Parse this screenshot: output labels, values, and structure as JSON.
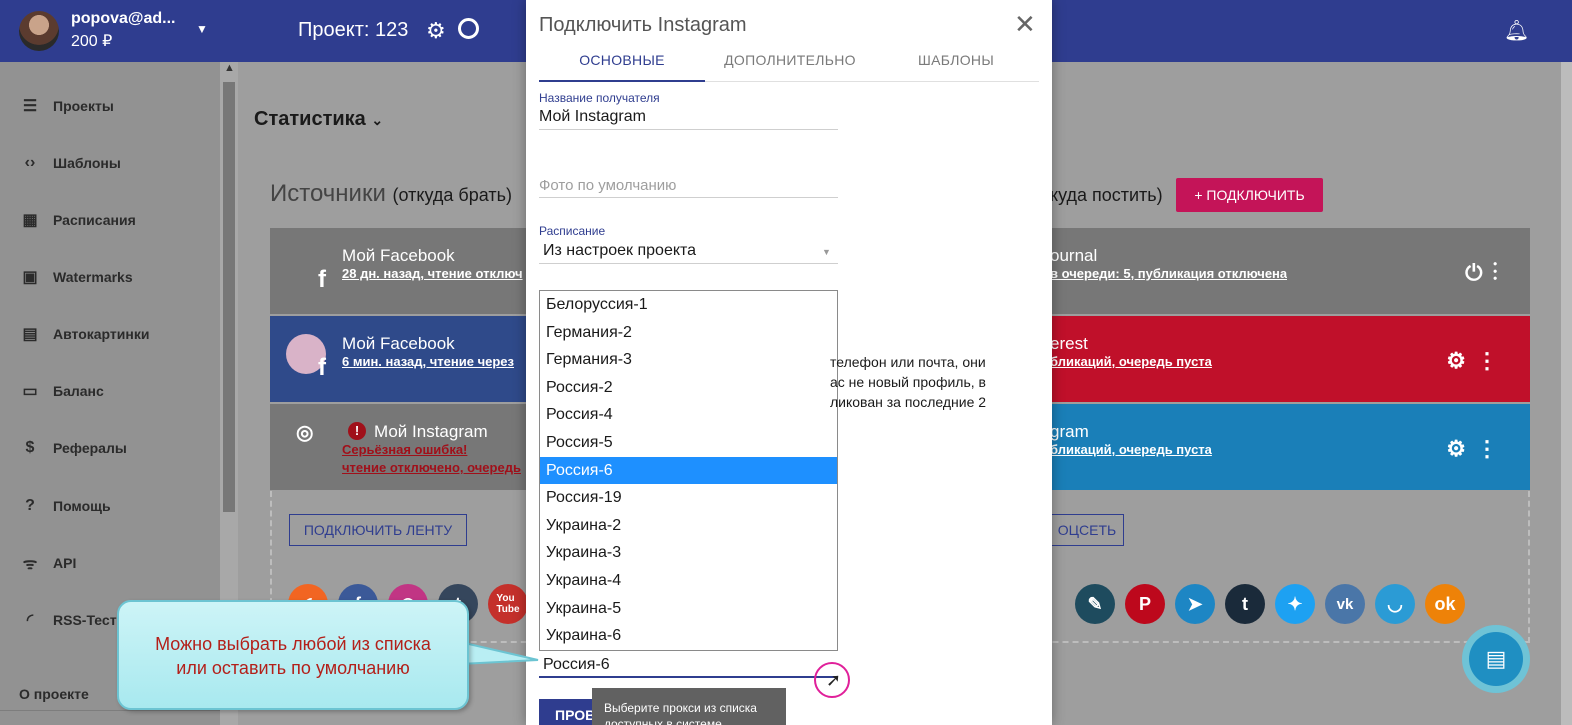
{
  "topbar": {
    "user_name": "popova@ad...",
    "user_balance": "200 ₽",
    "project_title": "Проект: 123"
  },
  "sidebar": {
    "items": [
      {
        "label": "Проекты",
        "icon": "list-icon"
      },
      {
        "label": "Шаблоны",
        "icon": "code-icon"
      },
      {
        "label": "Расписания",
        "icon": "calendar-icon"
      },
      {
        "label": "Watermarks",
        "icon": "watermark-icon"
      },
      {
        "label": "Автокартинки",
        "icon": "autoimage-icon"
      },
      {
        "label": "Баланс",
        "icon": "card-icon"
      },
      {
        "label": "Рефералы",
        "icon": "dollar-icon"
      },
      {
        "label": "Помощь",
        "icon": "help-icon"
      },
      {
        "label": "API",
        "icon": "api-icon"
      },
      {
        "label": "RSS-Тест",
        "icon": "rss-icon"
      }
    ],
    "about": "О проекте"
  },
  "main": {
    "stat_title": "Статистика",
    "sources_title": "Источники",
    "sources_hint": "(откуда брать)",
    "targets_hint": "куда постить)",
    "connect_button": "+ ПОДКЛЮЧИТЬ",
    "connect_feed_button": "ПОДКЛЮЧИТЬ ЛЕНТУ",
    "connect_net_button": "ОЦСЕТЬ",
    "sources": [
      {
        "name": "Мой Facebook",
        "sub": "28 дн. назад, чтение отключ",
        "color": "#777777"
      },
      {
        "name": "Мой Facebook",
        "sub": "6 мин. назад, чтение через ",
        "color": "#2f4a8a"
      },
      {
        "name": "Мой Instagram",
        "sub": "Серьёзная ошибка!",
        "sub2": "чтение отключено, очередь",
        "color": "#777777"
      }
    ],
    "targets": [
      {
        "name": "ournal",
        "sub": "в очереди: 5, публикация отключена",
        "color": "#777777"
      },
      {
        "name": "erest",
        "sub": "бликаций, очередь пуста",
        "color": "#c0102a"
      },
      {
        "name": "gram",
        "sub": "бликаций, очередь пуста",
        "color": "#1a7fb8"
      }
    ]
  },
  "dialog": {
    "title": "Подключить Instagram",
    "tabs": [
      "ОСНОВНЫЕ",
      "ДОПОЛНИТЕЛЬНО",
      "ШАБЛОНЫ"
    ],
    "recipient_label": "Название получателя",
    "recipient_value": "Мой Instagram",
    "photo_placeholder": "Фото по умолчанию",
    "schedule_label": "Расписание",
    "schedule_value": "Из настроек проекта",
    "proxy_options": [
      "Белоруссия-1",
      "Германия-2",
      "Германия-3",
      "Россия-2",
      "Россия-4",
      "Россия-5",
      "Россия-6",
      "Россия-19",
      "Украина-2",
      "Украина-3",
      "Украина-4",
      "Украина-5",
      "Украина-6"
    ],
    "proxy_selected_index": 6,
    "proxy_value": "Россия-6",
    "info_text_1": "телефон или почта, они",
    "info_text_2": "ас не новый профиль, в",
    "info_text_3": "ликован за последние 2",
    "check_button": "ПРОВ",
    "tooltip": "Выберите прокси из списка доступных в системе"
  },
  "callout": {
    "line1": "Можно выбрать любой из списка",
    "line2": "или оставить по умолчанию"
  }
}
